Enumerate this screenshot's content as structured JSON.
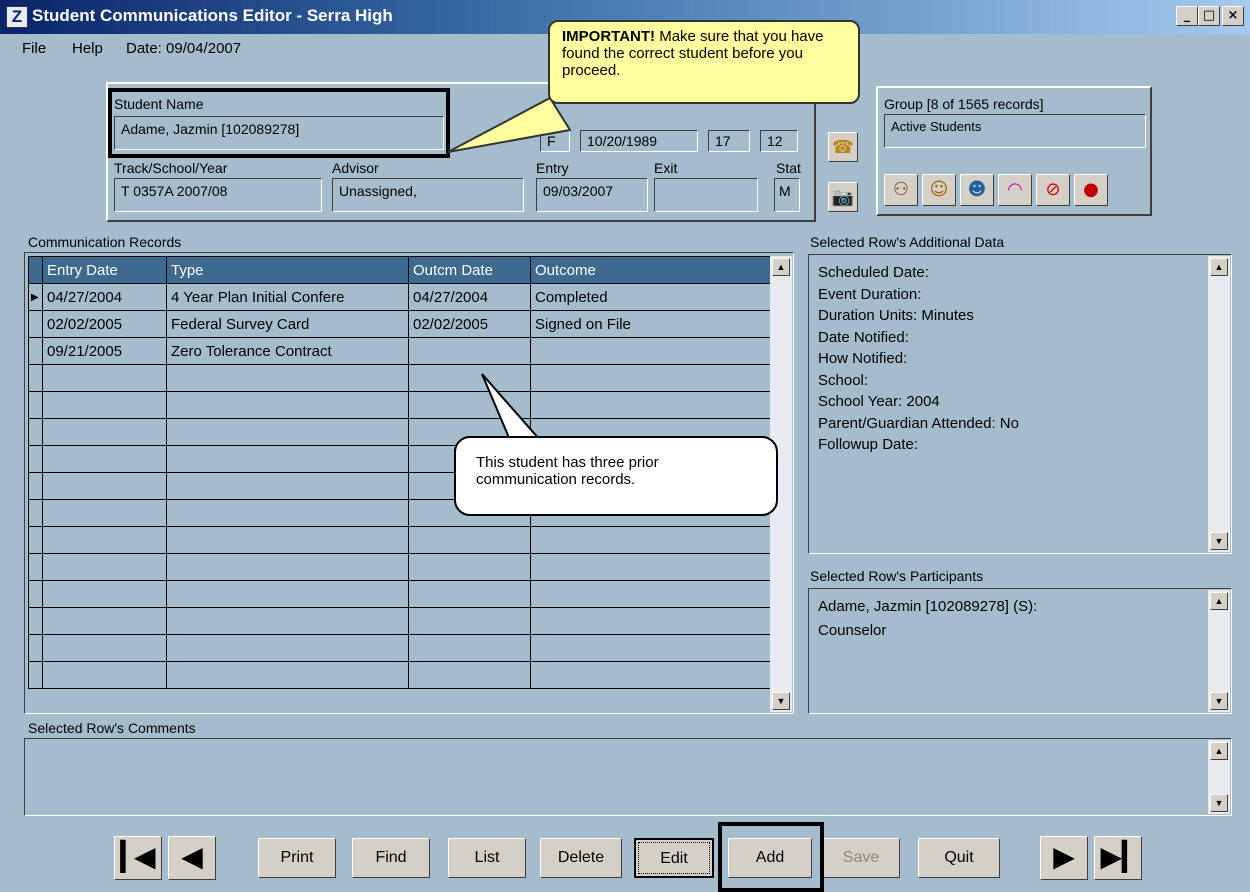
{
  "window": {
    "title": "Student Communications Editor - Serra High",
    "icon_letter": "Z",
    "min": "_",
    "max": "□",
    "close": "×"
  },
  "menu": {
    "file": "File",
    "help": "Help",
    "date": "Date: 09/04/2007"
  },
  "student": {
    "name_label": "Student Name",
    "name_value": "Adame, Jazmin [102089278]",
    "gender": "F",
    "birthdate": "10/20/1989",
    "age": "17",
    "grade": "12",
    "track_label": "Track/School/Year",
    "track_value": "T 0357A 2007/08",
    "advisor_label": "Advisor",
    "advisor_value": "Unassigned,",
    "entry_label": "Entry",
    "entry_value": "09/03/2007",
    "exit_label": "Exit",
    "exit_value": "",
    "stat_label": "Stat",
    "stat_value": "M"
  },
  "group": {
    "label": "Group  [8 of 1565 records]",
    "value": "Active Students"
  },
  "records": {
    "label": "Communication Records",
    "columns": [
      "Entry Date",
      "Type",
      "Outcm Date",
      "Outcome"
    ],
    "rows": [
      [
        "04/27/2004",
        "4 Year Plan Initial Confere",
        "04/27/2004",
        "Completed"
      ],
      [
        "02/02/2005",
        "Federal Survey Card",
        "02/02/2005",
        "Signed on File"
      ],
      [
        "09/21/2005",
        "Zero Tolerance Contract",
        "",
        ""
      ]
    ],
    "empty_rows": 12
  },
  "additional": {
    "label": "Selected Row's Additional Data",
    "lines": [
      "Scheduled Date:",
      "Event Duration:",
      "Duration Units:  Minutes",
      "Date Notified:",
      "How Notified:",
      "School:",
      "School Year:  2004",
      "Parent/Guardian Attended:  No",
      "Followup Date:"
    ]
  },
  "participants": {
    "label": "Selected Row's Participants",
    "line1": "Adame, Jazmin [102089278] (S):",
    "line2": "Counselor"
  },
  "comments": {
    "label": "Selected Row's Comments"
  },
  "buttons": {
    "print": "Print",
    "find": "Find",
    "list": "List",
    "delete": "Delete",
    "edit": "Edit",
    "add": "Add",
    "save": "Save",
    "quit": "Quit",
    "first": "◀",
    "prev": "◀",
    "next": "▶",
    "last": "▶"
  },
  "callouts": {
    "important_bold": "IMPORTANT!",
    "important_rest": " Make sure that you have found the correct student before you proceed.",
    "records_note": "This student has three prior communication records."
  }
}
